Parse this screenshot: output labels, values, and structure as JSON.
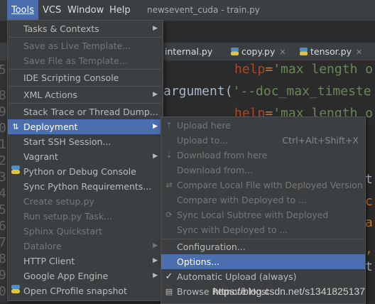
{
  "menubar": {
    "items": [
      {
        "label": "Tools",
        "active": true
      },
      {
        "label": "VCS",
        "active": false
      },
      {
        "label": "Window",
        "active": false
      },
      {
        "label": "Help",
        "active": false
      }
    ],
    "title": "newsevent_cuda - train.py"
  },
  "tabs": [
    {
      "label": "internal.py"
    },
    {
      "label": "copy.py"
    },
    {
      "label": "tensor.py"
    }
  ],
  "editor": {
    "line_numbers": [
      "5",
      "8",
      "9",
      "0",
      "1",
      "2",
      "3",
      "4",
      "5",
      "6",
      "7",
      "8",
      "9",
      "0",
      "1",
      "2"
    ],
    "lines": [
      {
        "kw": "help",
        "eq": "=",
        "str": "'max length o"
      },
      {
        "plain": "argument(",
        "str": "'--doc_max_timeste"
      },
      {
        "kw": "help",
        "eq": "=",
        "str": "'max length o"
      }
    ],
    "right_fragments": [
      "t",
      "c",
      "a",
      ",",
      "t"
    ]
  },
  "tools_menu": [
    {
      "label": "Tasks & Contexts",
      "submenu": true,
      "disabled": false
    },
    {
      "label": "Save as Live Template...",
      "disabled": true
    },
    {
      "label": "Save File as Template...",
      "disabled": true
    },
    {
      "label": "IDE Scripting Console",
      "disabled": false
    },
    {
      "label": "XML Actions",
      "submenu": true,
      "disabled": false
    },
    {
      "label": "Stack Trace or Thread Dump...",
      "disabled": false
    },
    {
      "label": "Deployment",
      "submenu": true,
      "selected": true,
      "icon": "deployment-icon"
    },
    {
      "label": "Start SSH Session...",
      "disabled": false
    },
    {
      "label": "Vagrant",
      "submenu": true,
      "disabled": false
    },
    {
      "label": "Python or Debug Console",
      "disabled": false,
      "icon": "python-icon"
    },
    {
      "label": "Sync Python Requirements...",
      "disabled": false
    },
    {
      "label": "Create setup.py",
      "disabled": true
    },
    {
      "label": "Run setup.py Task...",
      "disabled": true
    },
    {
      "label": "Sphinx Quickstart",
      "disabled": true
    },
    {
      "label": "Datalore",
      "submenu": true,
      "disabled": true
    },
    {
      "label": "HTTP Client",
      "submenu": true,
      "disabled": false
    },
    {
      "label": "Google App Engine",
      "submenu": true,
      "disabled": false
    },
    {
      "label": "Open CProfile snapshot",
      "disabled": false,
      "icon": "python-icon"
    }
  ],
  "deployment_menu": [
    {
      "label": "Upload here",
      "disabled": true,
      "icon": "upload-icon"
    },
    {
      "label": "Upload to...",
      "shortcut": "Ctrl+Alt+Shift+X",
      "disabled": true
    },
    {
      "label": "Download from here",
      "disabled": true,
      "icon": "download-icon"
    },
    {
      "label": "Download from...",
      "disabled": true
    },
    {
      "label": "Compare Local File with Deployed Version",
      "disabled": true,
      "icon": "compare-icon"
    },
    {
      "label": "Compare with Deployed to ...",
      "disabled": true
    },
    {
      "label": "Sync Local Subtree with Deployed",
      "disabled": true,
      "icon": "sync-icon"
    },
    {
      "label": "Sync with Deployed to ...",
      "disabled": true
    },
    {
      "label": "Configuration...",
      "disabled": false
    },
    {
      "label": "Options...",
      "disabled": false,
      "selected": true
    },
    {
      "label": "Automatic Upload (always)",
      "disabled": false,
      "checked": true
    },
    {
      "label": "Browse Remote Host",
      "disabled": false,
      "icon": "remote-host-icon"
    }
  ],
  "watermark": "https://blog.csdn.net/s1341825137",
  "colors": {
    "accent": "#4b6eaf",
    "menu_bg": "#3c3f41",
    "editor_bg": "#2b2b2b"
  }
}
